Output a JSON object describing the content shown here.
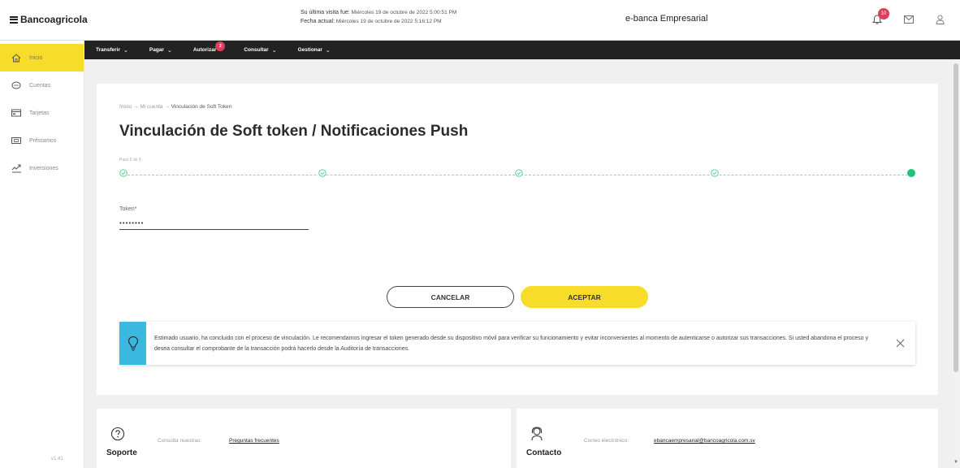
{
  "header": {
    "logo_text": "Bancoagricola",
    "last_visit_label": "Su última visita fue:",
    "last_visit_value": "Miércoles 19 de octubre de 2022 5:00:51 PM",
    "current_date_label": "Fecha actual:",
    "current_date_value": "Miércoles 19 de octubre de 2022 5:16:12 PM",
    "product_name": "e-banca Empresarial",
    "notification_count": "10"
  },
  "sidebar": {
    "items": [
      {
        "label": "Inicio",
        "icon": "home-icon"
      },
      {
        "label": "Cuentas",
        "icon": "wallet-icon"
      },
      {
        "label": "Tarjetas",
        "icon": "card-icon"
      },
      {
        "label": "Préstamos",
        "icon": "loan-icon"
      },
      {
        "label": "Inversiones",
        "icon": "investment-icon"
      }
    ],
    "version": "v1.41"
  },
  "navbar": {
    "items": [
      {
        "label": "Transferir"
      },
      {
        "label": "Pagar"
      },
      {
        "label": "Autorizar",
        "badge": "2"
      },
      {
        "label": "Consultar"
      },
      {
        "label": "Gestionar"
      }
    ]
  },
  "main": {
    "breadcrumb": {
      "part1": "Inicio",
      "part2": "Mi cuenta",
      "current": "Vinculación de Soft Token"
    },
    "title": "Vinculación de Soft token / Notificaciones Push",
    "step_label": "Paso 5 de 5",
    "token_label": "Token*",
    "token_value": "••••••••",
    "cancel_label": "CANCELAR",
    "accept_label": "ACEPTAR",
    "alert_text": "Estimado usuario, ha concluido con el proceso de vinculación. Le recomendamos ingresar el token generado desde su dispositivo móvil para verificar su funcionamiento y evitar inconvenientes al momento de autenticarse o autorizar sus transacciones. Si usted abandona el proceso y desea consultar el comprobante de la transacción podrá hacerlo desde la Auditoría de transacciones."
  },
  "footer": {
    "support": {
      "title": "Soporte",
      "desc": "Consulta nuestras:",
      "link": "Preguntas frecuentes"
    },
    "contact": {
      "title": "Contacto",
      "desc": "Correo electrónico:",
      "link": "ebancaempresarial@bancoagricola.com.sv"
    }
  },
  "colors": {
    "accent_yellow": "#f8dc2a",
    "nav_dark": "#222222",
    "success_green": "#1fc17b",
    "info_blue": "#3bb8e0",
    "badge_red": "#e43c5c"
  }
}
